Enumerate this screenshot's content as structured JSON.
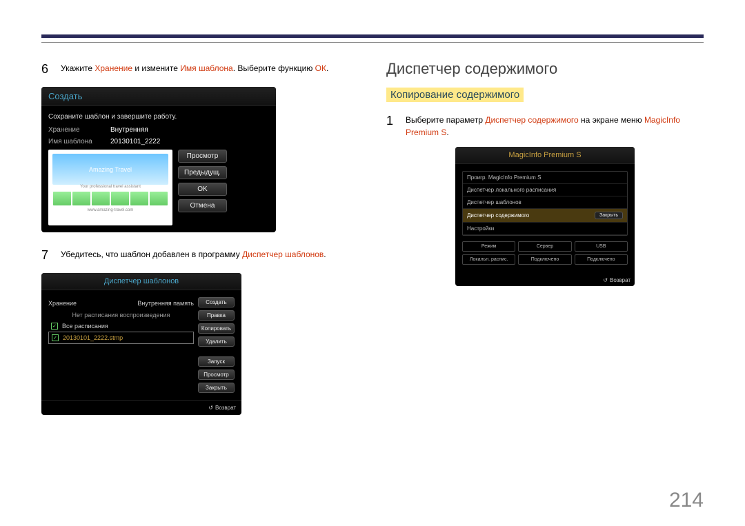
{
  "page_number": "214",
  "left": {
    "step6": {
      "num": "6",
      "t1": "Укажите ",
      "h1": "Хранение",
      "t2": " и измените ",
      "h2": "Имя шаблона",
      "t3": ". Выберите функцию ",
      "h3": "ОК",
      "t4": "."
    },
    "step7": {
      "num": "7",
      "t1": "Убедитесь, что шаблон добавлен в программу ",
      "h1": "Диспетчер шаблонов",
      "t2": "."
    }
  },
  "right": {
    "title": "Диспетчер содержимого",
    "subtitle": "Копирование содержимого",
    "step1": {
      "num": "1",
      "t1": "Выберите параметр ",
      "h1": "Диспетчер содержимого",
      "t2": " на экране меню ",
      "h2": "MagicInfo Premium S",
      "t3": "."
    }
  },
  "panelA": {
    "title": "Создать",
    "msg": "Сохраните шаблон и завершите работу.",
    "row1_lbl": "Хранение",
    "row1_val": "Внутренняя",
    "row2_lbl": "Имя шаблона",
    "row2_val": "20130101_2222",
    "thumb_title": "Amazing Travel",
    "thumb_sub": "Your professional travel assistant",
    "thumb_url": "www.amazing-travel.com",
    "btns": [
      "Просмотр",
      "Предыдущ.",
      "OK",
      "Отмена"
    ]
  },
  "panelB": {
    "title": "Диспетчер шаблонов",
    "head_l": "Хранение",
    "head_r": "Внутренняя память",
    "sub": "Нет расписания воспроизведения",
    "item_all": "Все расписания",
    "item_file": "20130101_2222.stmp",
    "btns": [
      "Создать",
      "Правка",
      "Копировать",
      "Удалить",
      "Запуск",
      "Просмотр",
      "Закрыть"
    ],
    "return": "Возврат"
  },
  "panelC": {
    "title": "MagicInfo Premium S",
    "rows": [
      "Проигр. MagicInfo Premium S",
      "Диспетчер локального расписания",
      "Диспетчер шаблонов"
    ],
    "sel": "Диспетчер содержимого",
    "sel_btn": "Закрыть",
    "row_last": "Настройки",
    "grid1": [
      "Режим",
      "Сервер",
      "USB"
    ],
    "grid2": [
      "Локальн. распис.",
      "Подключено",
      "Подключено"
    ],
    "return": "Возврат"
  }
}
